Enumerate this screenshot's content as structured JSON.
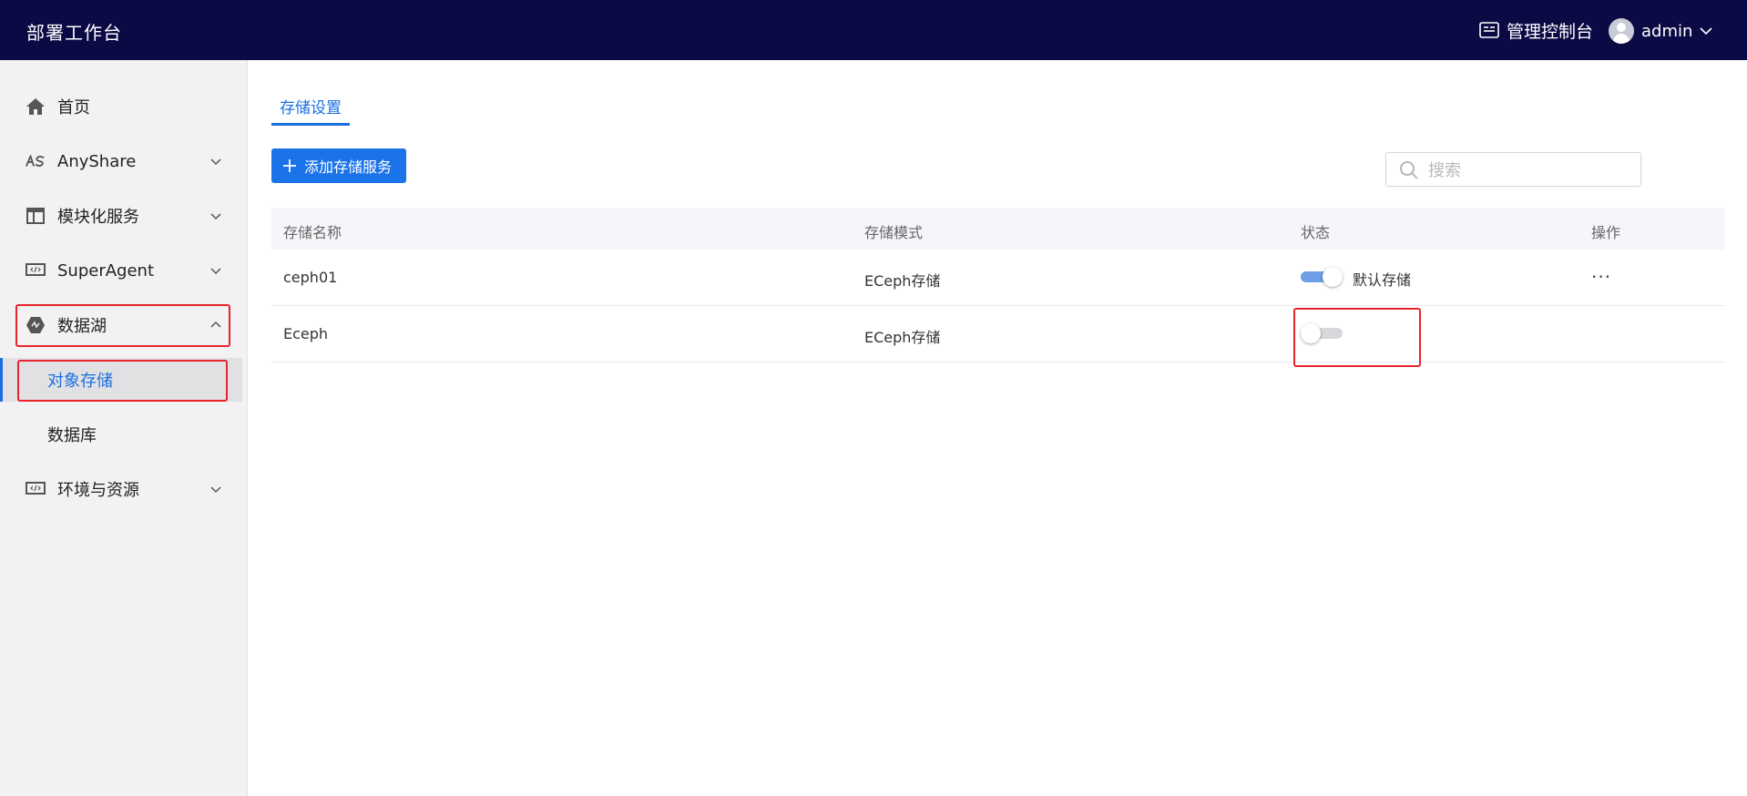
{
  "header": {
    "brand": "部署工作台",
    "console_label": "管理控制台",
    "user_name": "admin"
  },
  "sidebar": {
    "items": [
      {
        "label": "首页",
        "icon": "home-icon"
      },
      {
        "label": "AnyShare",
        "icon": "anyshare-icon"
      },
      {
        "label": "模块化服务",
        "icon": "layout-icon"
      },
      {
        "label": "SuperAgent",
        "icon": "code-icon"
      },
      {
        "label": "数据湖",
        "icon": "datalake-icon"
      },
      {
        "label": "环境与资源",
        "icon": "code-icon"
      }
    ],
    "sub_items": [
      {
        "label": "对象存储",
        "active": true
      },
      {
        "label": "数据库",
        "active": false
      }
    ]
  },
  "main": {
    "tab_label": "存储设置",
    "add_button_label": "添加存储服务",
    "search_placeholder": "搜索",
    "table": {
      "headers": [
        "存储名称",
        "存储模式",
        "状态",
        "操作"
      ],
      "rows": [
        {
          "name": "ceph01",
          "mode": "ECeph存储",
          "enabled": true,
          "status_label": "默认存储",
          "action": "···"
        },
        {
          "name": "Eceph",
          "mode": "ECeph存储",
          "enabled": false,
          "status_label": "",
          "action": ""
        }
      ]
    }
  },
  "colors": {
    "header_bg": "#0b0a45",
    "accent": "#1a73e8",
    "highlight": "#e8242b"
  }
}
